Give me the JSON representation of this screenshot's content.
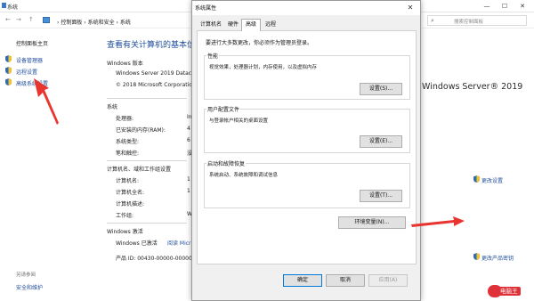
{
  "system_window": {
    "title": "系统",
    "controls": {
      "minimize": "—",
      "maximize": "☐",
      "close": "✕"
    },
    "nav": {
      "back": "←",
      "forward": "→",
      "up": "↑"
    },
    "breadcrumbs": [
      "控制面板",
      "系统和安全",
      "系统"
    ],
    "breadcrumb_sep": "›",
    "search_placeholder": "搜索控制面板",
    "left_pane": {
      "home": "控制面板主页",
      "links": [
        "设备管理器",
        "远程设置",
        "高级系统设置"
      ],
      "see_also": "另请参阅",
      "security": "安全和维护"
    },
    "main_title": "查看有关计算机的基本信息",
    "edition": {
      "heading": "Windows 版本",
      "name": "Windows Server 2019 Datacenter",
      "copyright": "© 2018 Microsoft Corporation"
    },
    "brand": "Windows Server® 2019",
    "system": {
      "heading": "系统",
      "rows": [
        {
          "label": "处理器:",
          "value": "In"
        },
        {
          "label": "已安装的内存(RAM):",
          "value": "4"
        },
        {
          "label": "系统类型:",
          "value": "6"
        },
        {
          "label": "笔和触控:",
          "value": "没"
        }
      ]
    },
    "computer": {
      "heading": "计算机名、域和工作组设置",
      "rows": [
        {
          "label": "计算机名:",
          "value": "1"
        },
        {
          "label": "计算机全名:",
          "value": "1"
        },
        {
          "label": "计算机描述:",
          "value": ""
        },
        {
          "label": "工作组:",
          "value": "W"
        }
      ],
      "change_settings": "更改设置"
    },
    "activation": {
      "heading": "Windows 激活",
      "status": "Windows 已激活",
      "link": "阅读 Micr",
      "product_id": "产品 ID: 00430-00000-00000",
      "change_key": "更改产品密钥"
    },
    "watermark": "电脑王"
  },
  "dialog": {
    "title": "系统属性",
    "close": "✕",
    "tabs": [
      "计算机名",
      "硬件",
      "高级",
      "远程"
    ],
    "active_tab": "高级",
    "admin_note": "要进行大多数更改，你必须作为管理员登录。",
    "performance": {
      "title": "性能",
      "desc": "视觉效果，处理器计划，内存使用，以及虚拟内存",
      "button": "设置(S)..."
    },
    "profiles": {
      "title": "用户配置文件",
      "desc": "与登录帐户相关的桌面设置",
      "button": "设置(E)..."
    },
    "startup": {
      "title": "启动和故障恢复",
      "desc": "系统启动、系统故障和调试信息",
      "button": "设置(T)..."
    },
    "env_button": "环境变量(N)...",
    "ok": "确定",
    "cancel": "取消",
    "apply": "应用(A)"
  },
  "colors": {
    "link_blue": "#1f4e9c",
    "annotation_red": "#e8352f",
    "watermark_red": "#e0313a",
    "focus_blue": "#0078d7"
  }
}
